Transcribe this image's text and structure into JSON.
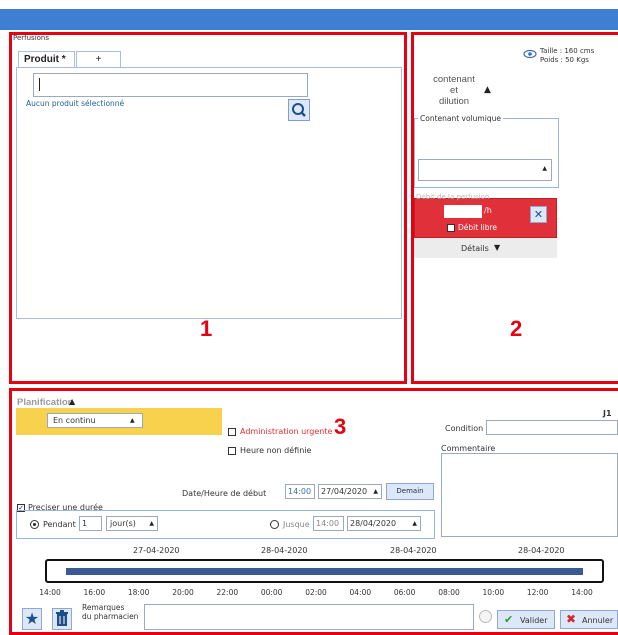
{
  "window": {
    "title": "Perfusions"
  },
  "products": {
    "tab_active": "Produit *",
    "tab_add": "+",
    "search_value": "",
    "none_selected": "Aucun produit sélectionné"
  },
  "patient": {
    "size": "Taille : 160 cms",
    "weight": "Poids : 50 Kgs"
  },
  "container": {
    "heading": "contenant\net\ndilution",
    "volumic_label": "Contenant volumique",
    "rate_label": "Débit de la perfusion",
    "rate_unit": "/h",
    "free_rate": "Débit libre",
    "details": "Détails"
  },
  "planning": {
    "heading": "Planification",
    "mode": "En continu",
    "urgent": "Administration urgente",
    "undefined_time": "Heure non définie",
    "condition_label": "Condition",
    "comment_label": "Commentaire",
    "j_label": "J1",
    "start_label": "Date/Heure de début",
    "start_time": "14:00",
    "start_date": "27/04/2020",
    "tomorrow": "Demain",
    "duration_label": "Preciser une durée",
    "during_label": "Pendant",
    "during_value": "1",
    "during_unit": "jour(s)",
    "until_label": "Jusque",
    "until_time": "14:00",
    "until_date": "28/04/2020"
  },
  "timeline": {
    "dates": [
      "27-04-2020",
      "28-04-2020",
      "28-04-2020",
      "28-04-2020"
    ],
    "hours": [
      "14:00",
      "16:00",
      "18:00",
      "20:00",
      "22:00",
      "00:00",
      "02:00",
      "04:00",
      "06:00",
      "08:00",
      "10:00",
      "12:00",
      "14:00"
    ]
  },
  "footer": {
    "remarks_label": "Remarques\ndu pharmacien",
    "validate": "Valider",
    "cancel": "Annuler"
  },
  "annotations": {
    "one": "1",
    "two": "2",
    "three": "3"
  },
  "colors": {
    "accent_blue": "#3f7fd3",
    "annotation_red": "#e60012",
    "rate_red": "#e0303a",
    "highlight_yellow": "#f8d24d"
  }
}
